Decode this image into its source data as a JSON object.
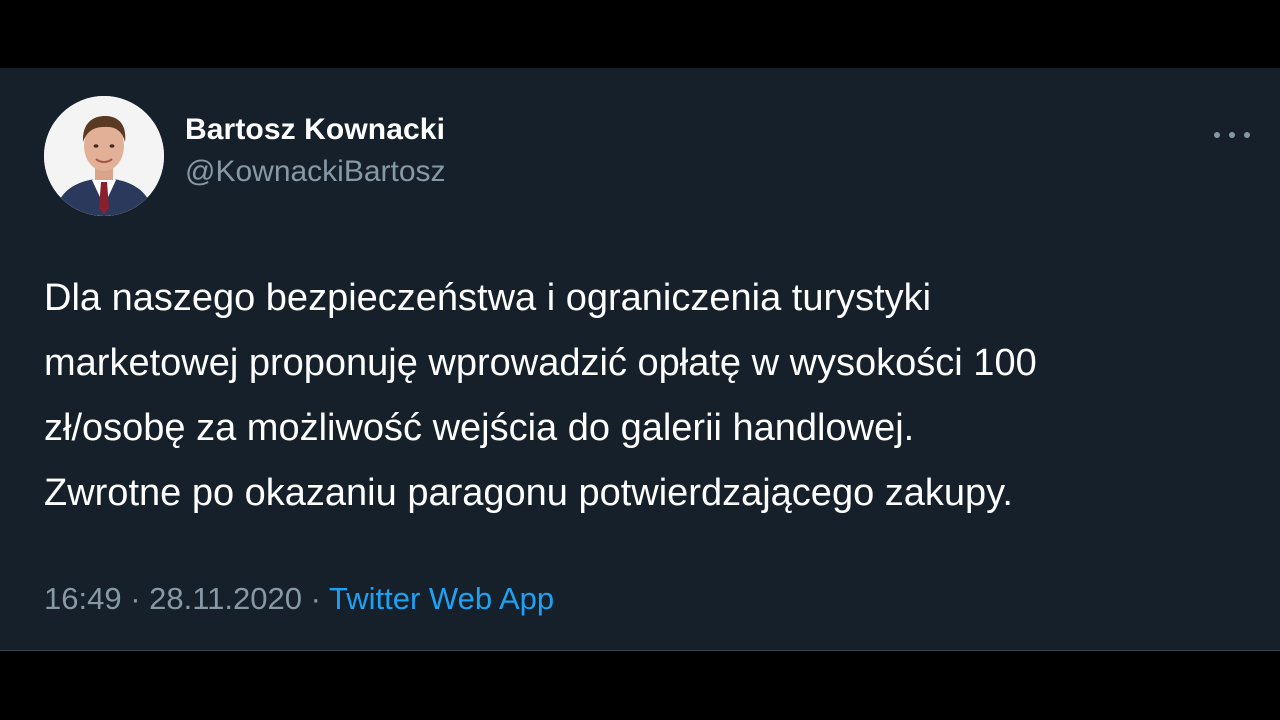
{
  "author": {
    "display_name": "Bartosz Kownacki",
    "handle": "@KownackiBartosz"
  },
  "tweet": {
    "text_lines": [
      "Dla naszego bezpieczeństwa i ograniczenia turystyki",
      "marketowej proponuję wprowadzić opłatę w wysokości 100",
      "zł/osobę za możliwość wejścia do galerii handlowej.",
      "Zwrotne po okazaniu paragonu potwierdzającego zakupy."
    ],
    "time": "16:49",
    "separator": " · ",
    "date": "28.11.2020",
    "source": "Twitter Web App"
  },
  "icons": {
    "more": "more-horizontal-icon",
    "avatar": "profile-photo"
  },
  "colors": {
    "background": "#15202b",
    "primary_text": "#ffffff",
    "secondary_text": "#8899a6",
    "link": "#1da1f2",
    "letterbox": "#000000"
  }
}
